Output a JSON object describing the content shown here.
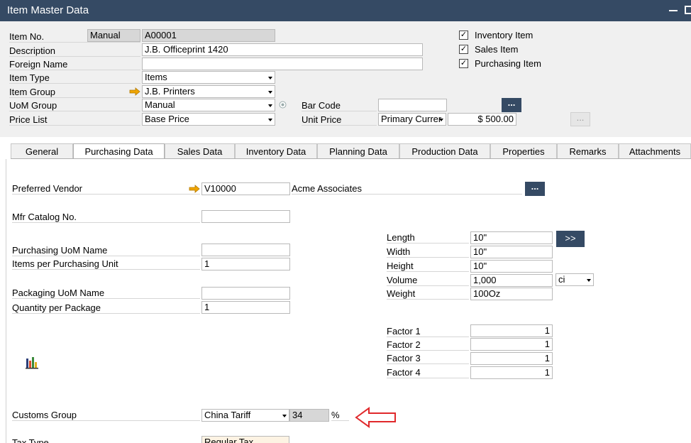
{
  "window": {
    "title": "Item Master Data"
  },
  "header": {
    "item_no_label": "Item No.",
    "item_no_series": "Manual",
    "item_no": "A00001",
    "description_label": "Description",
    "description": "J.B. Officeprint 1420",
    "foreign_name_label": "Foreign Name",
    "foreign_name": "",
    "item_type_label": "Item Type",
    "item_type": "Items",
    "item_group_label": "Item Group",
    "item_group": "J.B. Printers",
    "uom_group_label": "UoM Group",
    "uom_group": "Manual",
    "price_list_label": "Price List",
    "price_list": "Base Price",
    "bar_code_label": "Bar Code",
    "bar_code": "",
    "unit_price_label": "Unit Price",
    "currency": "Primary Currer",
    "unit_price": "$ 500.00",
    "dots": "..."
  },
  "checkboxes": [
    {
      "label": "Inventory Item",
      "checked": true
    },
    {
      "label": "Sales Item",
      "checked": true
    },
    {
      "label": "Purchasing Item",
      "checked": true
    }
  ],
  "tabs": [
    {
      "label": "General",
      "active": false
    },
    {
      "label": "Purchasing Data",
      "active": true
    },
    {
      "label": "Sales Data",
      "active": false
    },
    {
      "label": "Inventory Data",
      "active": false
    },
    {
      "label": "Planning Data",
      "active": false
    },
    {
      "label": "Production Data",
      "active": false
    },
    {
      "label": "Properties",
      "active": false
    },
    {
      "label": "Remarks",
      "active": false
    },
    {
      "label": "Attachments",
      "active": false
    }
  ],
  "purchasing": {
    "preferred_vendor_label": "Preferred Vendor",
    "preferred_vendor": "V10000",
    "vendor_name": "Acme Associates",
    "mfr_catalog_label": "Mfr Catalog No.",
    "mfr_catalog": "",
    "purch_uom_name_label": "Purchasing UoM Name",
    "purch_uom_name": "",
    "items_per_unit_label": "Items per Purchasing Unit",
    "items_per_unit": "1",
    "pkg_uom_name_label": "Packaging UoM Name",
    "pkg_uom_name": "",
    "qty_per_pkg_label": "Quantity per Package",
    "qty_per_pkg": "1",
    "length_label": "Length",
    "length": "10\"",
    "width_label": "Width",
    "width": "10\"",
    "height_label": "Height",
    "height": "10\"",
    "volume_label": "Volume",
    "volume": "1,000",
    "volume_unit": "ci",
    "weight_label": "Weight",
    "weight": "100Oz",
    "expand_label": ">>",
    "factors": [
      {
        "label": "Factor 1",
        "value": "1"
      },
      {
        "label": "Factor 2",
        "value": "1"
      },
      {
        "label": "Factor 3",
        "value": "1"
      },
      {
        "label": "Factor 4",
        "value": "1"
      }
    ],
    "customs_group_label": "Customs Group",
    "customs_group": "China Tariff",
    "customs_rate": "34",
    "percent_sign": "%",
    "tax_type_label": "Tax Type",
    "tax_type": "Regular Tax"
  },
  "colors": {
    "titlebar": "#354a64",
    "annotation_arrow": "#e0282b",
    "link_arrow": "#f0a500"
  },
  "icons": [
    "link-arrow-icon",
    "chart-icon",
    "red-arrow-icon",
    "info-icon"
  ]
}
